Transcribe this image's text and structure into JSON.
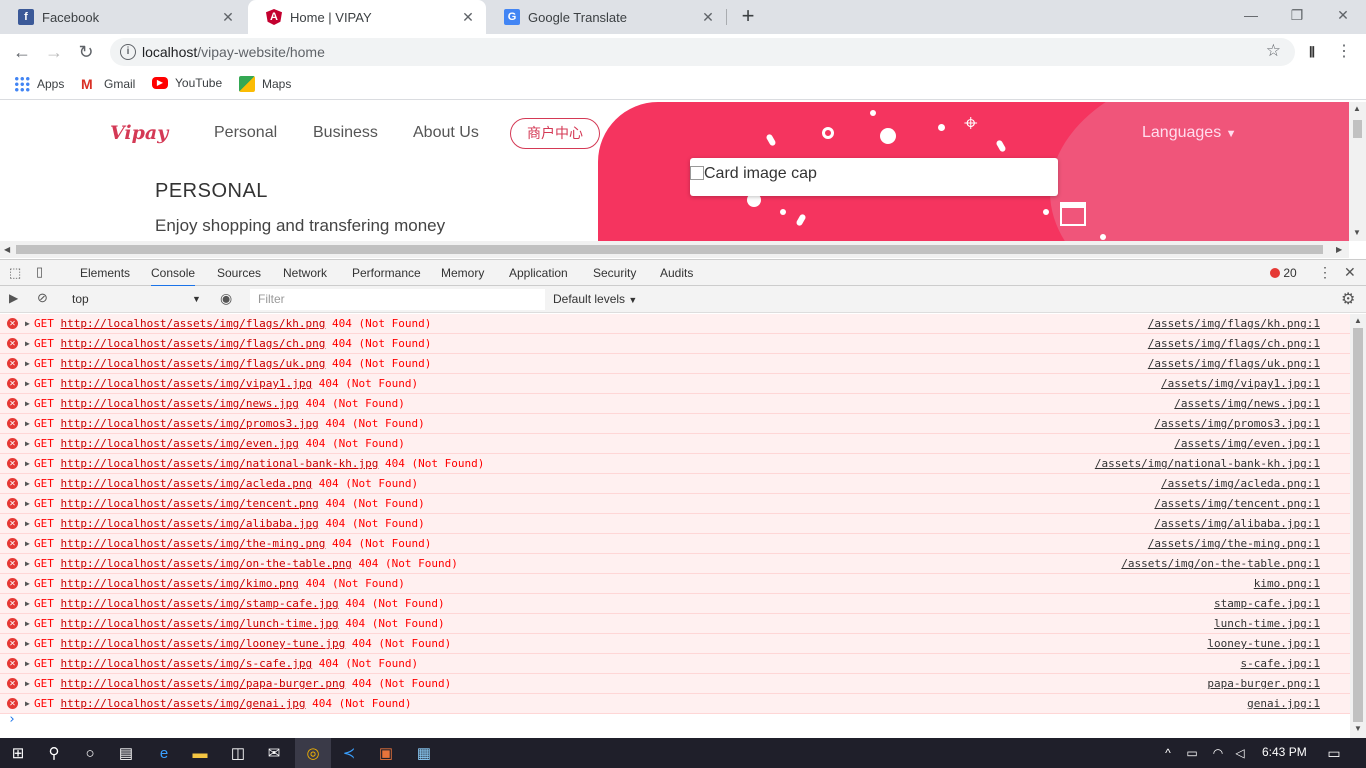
{
  "browser": {
    "tabs": [
      {
        "title": "Facebook",
        "icon": "facebook-icon",
        "color": "#3b5998"
      },
      {
        "title": "Home | VIPAY",
        "icon": "angular-icon",
        "color": "#c3002f"
      },
      {
        "title": "Google Translate",
        "icon": "translate-icon",
        "color": "#4285f4"
      }
    ],
    "url_host": "localhost",
    "url_path": "/vipay-website/home",
    "bookmarks": [
      "Apps",
      "Gmail",
      "YouTube",
      "Maps"
    ]
  },
  "site": {
    "logo": "Vipay",
    "nav": [
      "Personal",
      "Business",
      "About Us"
    ],
    "merchant_button": "商户中心",
    "languages": "Languages",
    "heading": "PERSONAL",
    "subheading": "Enjoy shopping and transfering money",
    "card_alt": "Card image cap",
    "brand_color": "#f5345f"
  },
  "devtools": {
    "tabs": [
      "Elements",
      "Console",
      "Sources",
      "Network",
      "Performance",
      "Memory",
      "Application",
      "Security",
      "Audits"
    ],
    "active_tab": "Console",
    "error_count": "20",
    "context": "top",
    "filter_placeholder": "Filter",
    "levels": "Default levels"
  },
  "console": {
    "entries": [
      {
        "url": "http://localhost/assets/img/flags/kh.png",
        "status": "404 (Not Found)",
        "source": "/assets/img/flags/kh.png:1"
      },
      {
        "url": "http://localhost/assets/img/flags/ch.png",
        "status": "404 (Not Found)",
        "source": "/assets/img/flags/ch.png:1"
      },
      {
        "url": "http://localhost/assets/img/flags/uk.png",
        "status": "404 (Not Found)",
        "source": "/assets/img/flags/uk.png:1"
      },
      {
        "url": "http://localhost/assets/img/vipay1.jpg",
        "status": "404 (Not Found)",
        "source": "/assets/img/vipay1.jpg:1"
      },
      {
        "url": "http://localhost/assets/img/news.jpg",
        "status": "404 (Not Found)",
        "source": "/assets/img/news.jpg:1"
      },
      {
        "url": "http://localhost/assets/img/promos3.jpg",
        "status": "404 (Not Found)",
        "source": "/assets/img/promos3.jpg:1"
      },
      {
        "url": "http://localhost/assets/img/even.jpg",
        "status": "404 (Not Found)",
        "source": "/assets/img/even.jpg:1"
      },
      {
        "url": "http://localhost/assets/img/national-bank-kh.jpg",
        "status": "404 (Not Found)",
        "source": "/assets/img/national-bank-kh.jpg:1"
      },
      {
        "url": "http://localhost/assets/img/acleda.png",
        "status": "404 (Not Found)",
        "source": "/assets/img/acleda.png:1"
      },
      {
        "url": "http://localhost/assets/img/tencent.png",
        "status": "404 (Not Found)",
        "source": "/assets/img/tencent.png:1"
      },
      {
        "url": "http://localhost/assets/img/alibaba.jpg",
        "status": "404 (Not Found)",
        "source": "/assets/img/alibaba.jpg:1"
      },
      {
        "url": "http://localhost/assets/img/the-ming.png",
        "status": "404 (Not Found)",
        "source": "/assets/img/the-ming.png:1"
      },
      {
        "url": "http://localhost/assets/img/on-the-table.png",
        "status": "404 (Not Found)",
        "source": "/assets/img/on-the-table.png:1"
      },
      {
        "url": "http://localhost/assets/img/kimo.png",
        "status": "404 (Not Found)",
        "source": "kimo.png:1"
      },
      {
        "url": "http://localhost/assets/img/stamp-cafe.jpg",
        "status": "404 (Not Found)",
        "source": "stamp-cafe.jpg:1"
      },
      {
        "url": "http://localhost/assets/img/lunch-time.jpg",
        "status": "404 (Not Found)",
        "source": "lunch-time.jpg:1"
      },
      {
        "url": "http://localhost/assets/img/looney-tune.jpg",
        "status": "404 (Not Found)",
        "source": "looney-tune.jpg:1"
      },
      {
        "url": "http://localhost/assets/img/s-cafe.jpg",
        "status": "404 (Not Found)",
        "source": "s-cafe.jpg:1"
      },
      {
        "url": "http://localhost/assets/img/papa-burger.png",
        "status": "404 (Not Found)",
        "source": "papa-burger.png:1"
      },
      {
        "url": "http://localhost/assets/img/genai.jpg",
        "status": "404 (Not Found)",
        "source": "genai.jpg:1"
      }
    ],
    "method": "GET"
  },
  "taskbar": {
    "time": "6:43 PM"
  }
}
